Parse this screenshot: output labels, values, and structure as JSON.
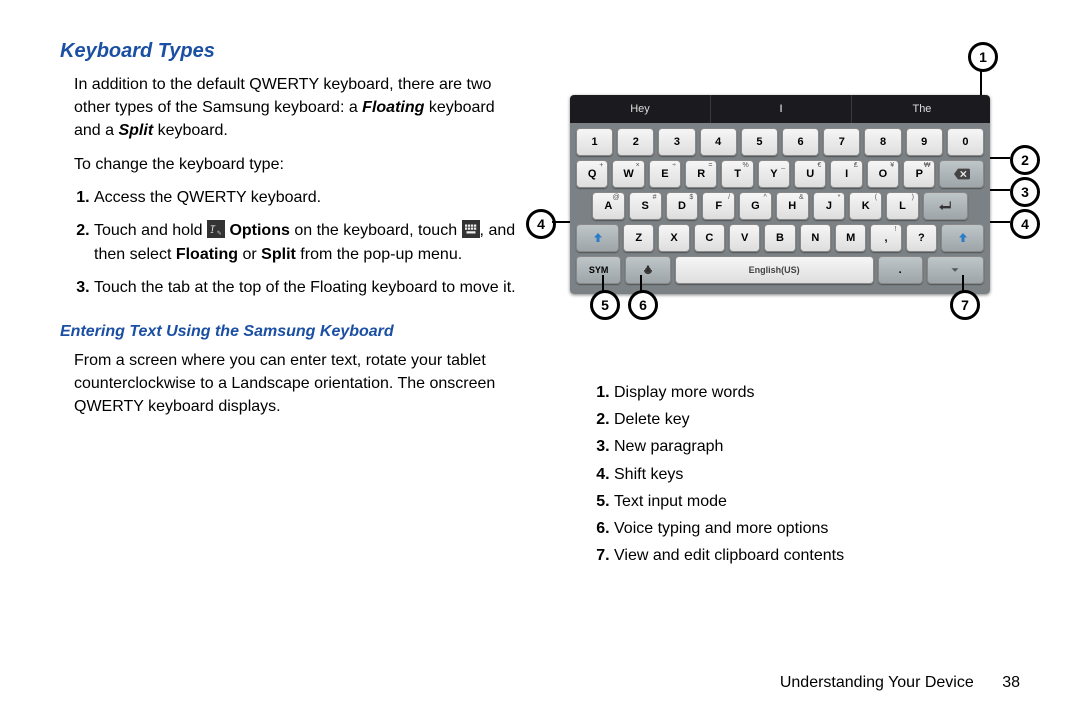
{
  "heading1": "Keyboard Types",
  "intro_pre": "In addition to the default QWERTY keyboard, there are two other types of the Samsung keyboard: a ",
  "intro_floating": "Floating",
  "intro_mid": " keyboard and a ",
  "intro_split": "Split",
  "intro_post": " keyboard.",
  "change_lead": "To change the keyboard type:",
  "step1": "Access the QWERTY keyboard.",
  "step2_pre": "Touch and hold ",
  "step2_options": "Options",
  "step2_mid": " on the keyboard, touch ",
  "step2_select": ", and then select ",
  "step2_floating": "Floating",
  "step2_or": " or ",
  "step2_split": "Split",
  "step2_post": " from the pop-up menu.",
  "step3": "Touch the tab at the top of the Floating keyboard to move it.",
  "heading2": "Entering Text Using the Samsung Keyboard",
  "enter_text_body": "From a screen where you can enter text, rotate your tablet counterclockwise to a Landscape orientation. The onscreen QWERTY keyboard displays.",
  "suggest": {
    "left": "Hey",
    "mid": "I",
    "right": "The"
  },
  "rows": {
    "r1": [
      "1",
      "2",
      "3",
      "4",
      "5",
      "6",
      "7",
      "8",
      "9",
      "0"
    ],
    "r2": [
      "Q",
      "W",
      "E",
      "R",
      "T",
      "Y",
      "U",
      "I",
      "O",
      "P"
    ],
    "r2sup": [
      "+",
      "×",
      "÷",
      "=",
      "%",
      "_",
      "€",
      "₤",
      "¥",
      "₩"
    ],
    "r3": [
      "A",
      "S",
      "D",
      "F",
      "G",
      "H",
      "J",
      "K",
      "L"
    ],
    "r3sup": [
      "@",
      "#",
      "$",
      "/",
      "^",
      "&",
      "*",
      "(",
      ")"
    ],
    "r4": [
      "Z",
      "X",
      "C",
      "V",
      "B",
      "N",
      "M",
      ",",
      "?"
    ],
    "r4sup": [
      "",
      "",
      "",
      "",
      "",
      "",
      "",
      "!",
      ""
    ],
    "sym": "SYM",
    "space": "English(US)"
  },
  "callouts": {
    "c1": "1",
    "c2": "2",
    "c3": "3",
    "c4l": "4",
    "c4r": "4",
    "c5": "5",
    "c6": "6",
    "c7": "7"
  },
  "legend": {
    "l1": "Display more words",
    "l2": "Delete key",
    "l3": "New paragraph",
    "l4": "Shift keys",
    "l5": "Text input mode",
    "l6": "Voice typing and more options",
    "l7": "View and edit clipboard contents"
  },
  "footer_section": "Understanding Your Device",
  "footer_page": "38"
}
